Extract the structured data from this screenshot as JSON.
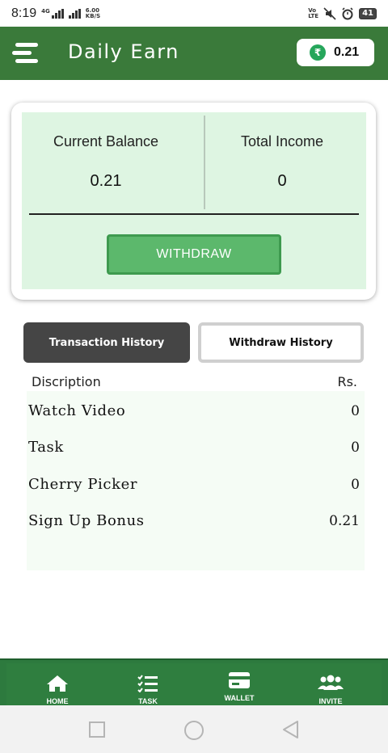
{
  "status_bar": {
    "time": "8:19",
    "network_speed_top": "6.00",
    "network_speed_unit": "KB/S",
    "net_type": "4G",
    "volte_top": "Vo",
    "volte_bottom": "LTE",
    "battery": "41"
  },
  "app_bar": {
    "title": "Daily Earn",
    "balance_chip_value": "0.21",
    "currency_symbol": "₹",
    "bar_color": "#3a7a3a"
  },
  "balance_card": {
    "current_balance_label": "Current Balance",
    "current_balance_value": "0.21",
    "total_income_label": "Total Income",
    "total_income_value": "0",
    "withdraw_label": "WITHDRAW",
    "panel_color": "#def5e2",
    "button_color": "#5cb86c"
  },
  "history_tabs": {
    "transaction_label": "Transaction History",
    "withdraw_label": "Withdraw History",
    "active_tab": "Transaction History"
  },
  "transactions": {
    "header_description": "Discription",
    "header_amount": "Rs.",
    "rows": [
      {
        "label": "Watch Video",
        "value": "0"
      },
      {
        "label": "Task",
        "value": "0"
      },
      {
        "label": "Cherry Picker",
        "value": "0"
      },
      {
        "label": "Sign Up Bonus",
        "value": "0.21"
      }
    ]
  },
  "bottom_nav": {
    "items": [
      {
        "label": "HOME",
        "icon": "home-icon"
      },
      {
        "label": "TASK",
        "icon": "task-list-icon"
      },
      {
        "label": "WALLET",
        "icon": "wallet-card-icon"
      },
      {
        "label": "INVITE",
        "icon": "people-icon"
      }
    ],
    "active": "WALLET",
    "bar_color": "#2d7a3e"
  },
  "system_nav": {
    "icons": [
      "recent-apps-icon",
      "home-circle-icon",
      "back-triangle-icon"
    ]
  }
}
